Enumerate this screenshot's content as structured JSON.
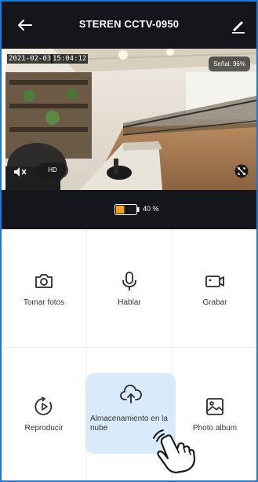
{
  "header": {
    "title": "STEREN CCTV-0950",
    "back_icon": "arrow-left-icon",
    "edit_icon": "pencil-icon"
  },
  "video": {
    "date": "2021-02-03",
    "time": "15:04:12",
    "signal": "Señal: 96%",
    "quality": "HD",
    "mute_icon": "speaker-mute-icon",
    "fullscreen_icon": "fullscreen-toggle-icon"
  },
  "battery": {
    "text": "40 %",
    "level": 0.4,
    "fill_color": "#f7a21b"
  },
  "actions": [
    {
      "label": "Tomar fotos",
      "icon": "camera-icon"
    },
    {
      "label": "Hablar",
      "icon": "microphone-icon"
    },
    {
      "label": "Grabar",
      "icon": "video-record-icon"
    },
    {
      "label": "Reproducir",
      "icon": "playback-icon"
    },
    {
      "label": "Almacenamiento en la nube",
      "icon": "cloud-upload-icon"
    },
    {
      "label": "Photo album",
      "icon": "image-album-icon"
    }
  ],
  "colors": {
    "header_bg": "#14161b",
    "frame_border": "#1e78d6",
    "selected_bg": "#d9ebfa"
  }
}
